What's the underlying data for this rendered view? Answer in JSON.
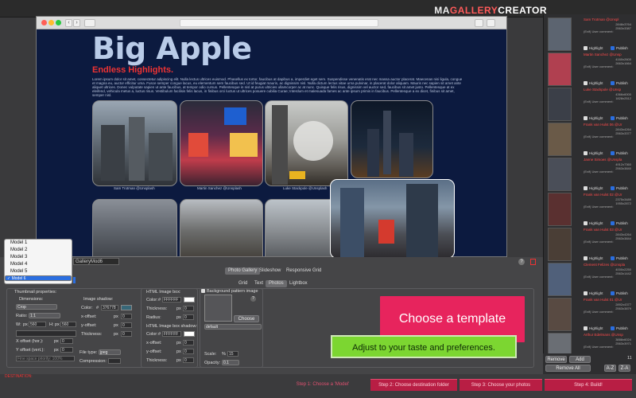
{
  "app": {
    "logo_a": "MA",
    "logo_b": "GALLERY",
    "logo_c": "CREATOR"
  },
  "browser": {
    "nav_back": "‹",
    "nav_fwd": "›"
  },
  "page": {
    "title": "Big Apple",
    "subtitle": "Endless Highlights.",
    "lorem": "Lorem ipsum dolor sit amet, consectetur adipiscing elit. Nulla lectus ultrices euismod. Phasellus ex tortor, faucibus at dapibus a, imperdiet eget sem. Suspendisse venenatis erat nec massa auctor placerat. Maecenas nisi ligula, congue et magna eu, auctor efficitur uma. Fusce semper congue lacus, eu elementum sem faucibus sed. Ut id feugiat mauris, ac dignissim nisl. Nulla dictum lectus vitae urna pulvinar, in placerat dolor aliquam. Mauris nec sapien sit amet ante aliquet ultrices. Donec vulputate sapien ut ante faucibus, at tempor odio cursus. Pellentesque in nisl at purus ultricies ullamcorper ac at nunc. Quisque felis risus, dignissim vel auctor sed, faucibus sit amet justo. Pellentesque at ex eleifend, vehicula metus a, luctus risus. Vestibulum facilisis felis lacus, in finibus orci luctus ut ultrices posuere cubilia Curae; Interdum et malesuada fames ac ante ipsum primis in faucibus. Pellentesque a ex dicet, finibus sit amet, semper nisl.",
    "captions": [
      "Sam Trotman @Unsplash",
      "Martin Sanchez @Unsplash",
      "Luke Stackpole @Unsplash"
    ]
  },
  "models": {
    "items": [
      "Model 1",
      "Model 2",
      "Model 3",
      "Model 4",
      "Model 5",
      "Model 6"
    ],
    "selected": "Model 6",
    "check": "✓",
    "name_field": "GalleryMod6"
  },
  "main_tabs": [
    "Photo Gallery",
    "Slideshow",
    "Responsive Grid"
  ],
  "sub_tabs": [
    "Grid",
    "Text",
    "Photos",
    "Lightbox"
  ],
  "thumb": {
    "title": "Thumbnail properties:",
    "dimensions": "Dimensions:",
    "crop": "Crop",
    "ratio_lbl": "Ratio:",
    "ratio": "1:1",
    "w_lbl": "W:",
    "px": "px",
    "w": "560",
    "h_lbl": "H:",
    "h": "560",
    "xoff_lbl": "X offset (hor.):",
    "xoff": "0",
    "yoff_lbl": "Y offset (vert.):",
    "yoff": "0",
    "fine": "Fine space priority: 100%"
  },
  "shadow": {
    "title": "Image shadow:",
    "color_lbl": "Color:",
    "hash": "#",
    "color": "376778",
    "x_lbl": "x-offset:",
    "x": "0",
    "y_lbl": "y-offset:",
    "y": "0",
    "thick_lbl": "Thickness:",
    "thick": "0",
    "filetype_lbl": "File type:",
    "filetype": "jpeg",
    "compression_lbl": "Compression:"
  },
  "htmlbox": {
    "title": "HTML Image box:",
    "color_lbl": "Color:",
    "color": "FFFFFF",
    "thick_lbl": "Thickness:",
    "thick": "0",
    "radius_lbl": "Radius:",
    "radius": "0",
    "shadow_title": "HTML Image box shadow:",
    "scolor": "FFFFFF",
    "x_lbl": "x-offset:",
    "x": "0",
    "y_lbl": "y-offset:",
    "y": "0",
    "sthick_lbl": "Thickness:",
    "sthick": "0"
  },
  "bgpattern": {
    "label": "Background pattern image",
    "q": "?",
    "choose": "Choose",
    "default": "default",
    "scale_lbl": "Scale:",
    "pct": "%",
    "scale": "15",
    "opacity_lbl": "Opacity:",
    "opacity": "0.1"
  },
  "cta": {
    "primary": "Choose a template",
    "secondary": "Adjust to your taste and preferences."
  },
  "steps": [
    "Step 1: Choose a 'Model'",
    "Step 2: Choose destination folder",
    "Step 3: Choose your photos",
    "Step 4: Build!"
  ],
  "destination_label": "DESTINATION:",
  "sidebar": {
    "highlight": "Highlight",
    "publish": "Publish",
    "exif": "(Exif) User comment:",
    "items": [
      {
        "name": "Sam Trotman @Unspl",
        "dim": "2848x3764",
        "size": "2563x3387"
      },
      {
        "name": "Martin Sanchez @Unsp",
        "dim": "4160x2600",
        "size": "2663x1664"
      },
      {
        "name": "Luke Stackpole @Unsp",
        "dim": "4366x6000",
        "size": "1828x2512"
      },
      {
        "name": "Frank van Hulst 06 @Ur",
        "dim": "2843x4264",
        "size": "2563x3377"
      },
      {
        "name": "Janne Simoes @Unspla",
        "dim": "4912x7360",
        "size": "2563x3840"
      },
      {
        "name": "Frank van Hulst 02 @Ur",
        "dim": "2375x3489",
        "size": "1955x2872"
      },
      {
        "name": "Frank van Hulst 03 @Ur",
        "dim": "2843x4264",
        "size": "2563x3844"
      },
      {
        "name": "Clement Felizes @Unspla",
        "dim": "4000x2250",
        "size": "2563x1442"
      },
      {
        "name": "Frank van Hulst 01 @Ur",
        "dim": "2892x4377",
        "size": "2563x3879"
      },
      {
        "name": "Arthur Edelmans @Unsp",
        "dim": "3888x6024",
        "size": "2563x3971"
      }
    ],
    "remove": "Remove",
    "add": "Add",
    "remove_all": "Remove All",
    "count": "11",
    "sort_az": "A-Z",
    "sort_za": "Z-A"
  }
}
